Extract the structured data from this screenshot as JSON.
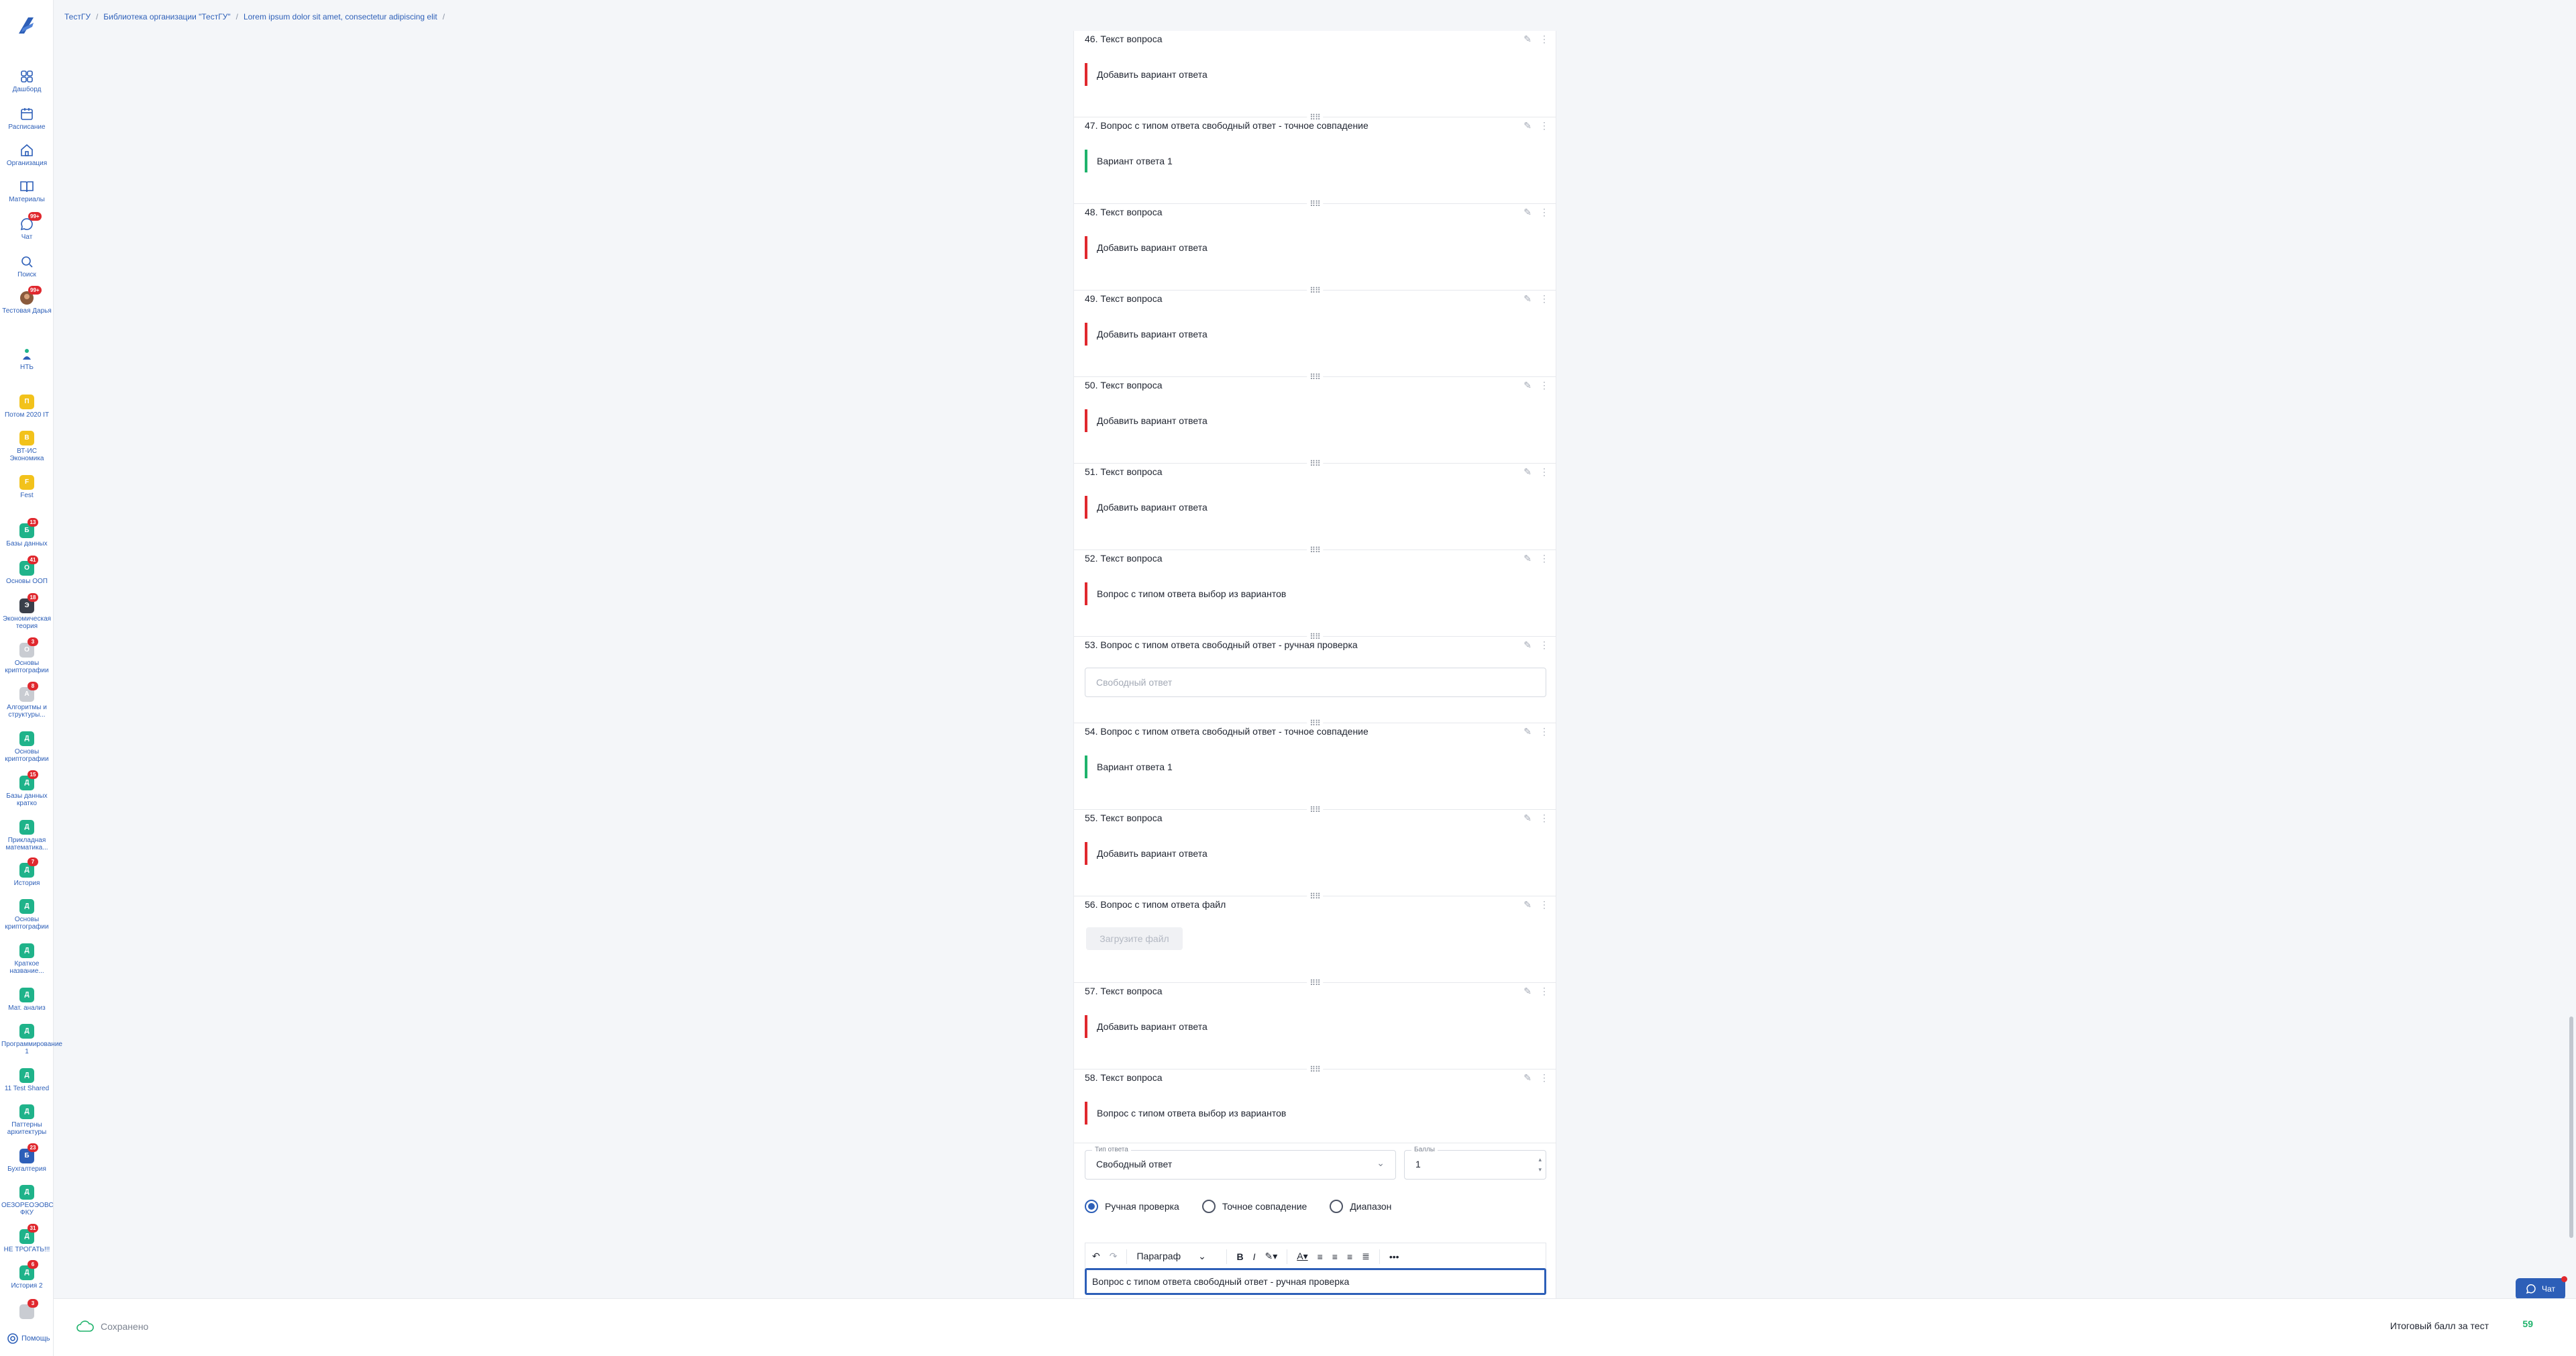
{
  "breadcrumb": [
    "ТестГУ",
    "Библиотека организации \"ТестГУ\"",
    "Lorem ipsum dolor sit amet, consectetur adipiscing elit"
  ],
  "nav": [
    {
      "label": "Дашборд",
      "icon": "dashboard-icon"
    },
    {
      "label": "Расписание",
      "icon": "calendar-icon"
    },
    {
      "label": "Организация",
      "icon": "organization-icon"
    },
    {
      "label": "Материалы",
      "icon": "book-icon"
    },
    {
      "label": "Чат",
      "icon": "chat-icon",
      "badge": "99+"
    },
    {
      "label": "Поиск",
      "icon": "search-icon"
    },
    {
      "label": "Тестовая Дарья",
      "icon": "user-avatar-icon",
      "badge": "99+"
    },
    {
      "label": "НТЬ",
      "icon": "tree-icon"
    }
  ],
  "courses": [
    {
      "label": "Потом 2020 IT",
      "letter": "П",
      "color": "#f2c21b"
    },
    {
      "label": "ВТ-ИС Экономика",
      "letter": "В",
      "color": "#f2c21b"
    },
    {
      "label": "Fest",
      "letter": "F",
      "color": "#f2c21b"
    },
    {
      "label": "Базы данных",
      "letter": "Б",
      "color": "#1fb38a",
      "badge": "13"
    },
    {
      "label": "Основы ООП",
      "letter": "О",
      "color": "#1fb38a",
      "badge": "41"
    },
    {
      "label": "Экономическая теория",
      "letter": "Э",
      "color": "#3a3f4a",
      "badge": "18"
    },
    {
      "label": "Основы криптографии",
      "letter": "О",
      "color": "#c9ccd2",
      "badge": "3"
    },
    {
      "label": "Алгоритмы и структуры...",
      "letter": "А",
      "color": "#c9ccd2",
      "badge": "8"
    },
    {
      "label": "Основы криптографии",
      "letter": "Д",
      "color": "#1fb38a"
    },
    {
      "label": "Базы данных кратко",
      "letter": "Д",
      "color": "#1fb38a",
      "badge": "15"
    },
    {
      "label": "Прикладная математика...",
      "letter": "Д",
      "color": "#1fb38a"
    },
    {
      "label": "История",
      "letter": "Д",
      "color": "#1fb38a",
      "badge": "7"
    },
    {
      "label": "Основы криптографии",
      "letter": "Д",
      "color": "#1fb38a"
    },
    {
      "label": "Краткое название...",
      "letter": "Д",
      "color": "#1fb38a"
    },
    {
      "label": "Мат. анализ",
      "letter": "Д",
      "color": "#1fb38a"
    },
    {
      "label": "Программирование 1",
      "letter": "Д",
      "color": "#1fb38a"
    },
    {
      "label": "11 Test Shared",
      "letter": "Д",
      "color": "#1fb38a"
    },
    {
      "label": "Паттерны архитектуры",
      "letter": "Д",
      "color": "#1fb38a"
    },
    {
      "label": "Бухгалтерия",
      "letter": "Б",
      "color": "#2d5fb8",
      "badge": "23"
    },
    {
      "label": "ОЕЗОРЕОЭОВС ФКУ",
      "letter": "Д",
      "color": "#1fb38a"
    },
    {
      "label": "НЕ ТРОГАТЬ!!!",
      "letter": "Д",
      "color": "#1fb38a",
      "badge": "31"
    },
    {
      "label": "История 2",
      "letter": "Д",
      "color": "#1fb38a",
      "badge": "6"
    },
    {
      "label": "",
      "letter": "",
      "color": "#c9ccd2",
      "badge": "3"
    }
  ],
  "help_label": "Помощь",
  "questions": [
    {
      "title": "46.  Текст вопроса",
      "kind": "answer",
      "answer": "Добавить вариант ответа",
      "color": "red"
    },
    {
      "title": "47.  Вопрос с типом ответа свободный ответ - точное совпадение",
      "kind": "answer",
      "answer": "Вариант ответа 1",
      "color": "green"
    },
    {
      "title": "48.  Текст вопроса",
      "kind": "answer",
      "answer": "Добавить вариант ответа",
      "color": "red"
    },
    {
      "title": "49.  Текст вопроса",
      "kind": "answer",
      "answer": "Добавить вариант ответа",
      "color": "red"
    },
    {
      "title": "50.  Текст вопроса",
      "kind": "answer",
      "answer": "Добавить вариант ответа",
      "color": "red"
    },
    {
      "title": "51.  Текст вопроса",
      "kind": "answer",
      "answer": "Добавить вариант ответа",
      "color": "red"
    },
    {
      "title": "52.  Текст вопроса",
      "kind": "answer",
      "answer": "Вопрос с типом ответа выбор из вариантов",
      "color": "red"
    },
    {
      "title": "53.  Вопрос с типом ответа свободный ответ - ручная проверка",
      "kind": "free",
      "answer": "Свободный ответ"
    },
    {
      "title": "54.  Вопрос с типом ответа свободный ответ - точное совпадение",
      "kind": "answer",
      "answer": "Вариант ответа 1",
      "color": "green"
    },
    {
      "title": "55.  Текст вопроса",
      "kind": "answer",
      "answer": "Добавить вариант ответа",
      "color": "red"
    },
    {
      "title": "56.  Вопрос с типом ответа файл",
      "kind": "file",
      "answer": "Загрузите файл"
    },
    {
      "title": "57.  Текст вопроса",
      "kind": "answer",
      "answer": "Добавить вариант ответа",
      "color": "red"
    },
    {
      "title": "58.  Текст вопроса",
      "kind": "answer",
      "answer": "Вопрос с типом ответа выбор из вариантов",
      "color": "red"
    }
  ],
  "editor": {
    "answer_type_legend": "Тип ответа",
    "answer_type_value": "Свободный ответ",
    "points_legend": "Баллы",
    "points_value": "1",
    "radios": [
      {
        "label": "Ручная проверка",
        "checked": true
      },
      {
        "label": "Точное совпадение",
        "checked": false
      },
      {
        "label": "Диапазон",
        "checked": false
      }
    ],
    "paragraph_label": "Параграф",
    "text": "Вопрос с типом ответа свободный ответ - ручная проверка"
  },
  "chat_button_label": "Чат",
  "footer": {
    "saved_label": "Сохранено",
    "total_label": "Итоговый балл за тест",
    "total_value": "59"
  }
}
